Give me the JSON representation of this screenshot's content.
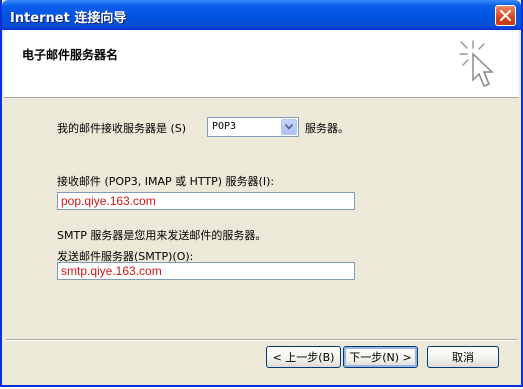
{
  "window": {
    "title": "Internet 连接向导"
  },
  "header": {
    "title": "电子邮件服务器名"
  },
  "form": {
    "incoming_type_label_pre": "我的邮件接收服务器是",
    "incoming_type_label_key": "(S)",
    "incoming_type_value": "POP3",
    "incoming_type_suffix": "服务器。",
    "incoming_server_label": "接收邮件 (POP3, IMAP 或 HTTP) 服务器(I):",
    "incoming_server_value": "pop.qiye.163.com",
    "smtp_note": "SMTP 服务器是您用来发送邮件的服务器。",
    "outgoing_server_label": "发送邮件服务器(SMTP)(O):",
    "outgoing_server_value": "smtp.qiye.163.com"
  },
  "buttons": {
    "back": "< 上一步(B)",
    "next": "下一步(N) >",
    "cancel": "取消"
  },
  "icons": {
    "close": "close-icon",
    "wizard": "cursor-sparkle-icon",
    "dropdown": "chevron-down-icon"
  },
  "colors": {
    "titlebar": "#0054e3",
    "field_text": "#d21818",
    "dialog_bg": "#ece9d8"
  }
}
